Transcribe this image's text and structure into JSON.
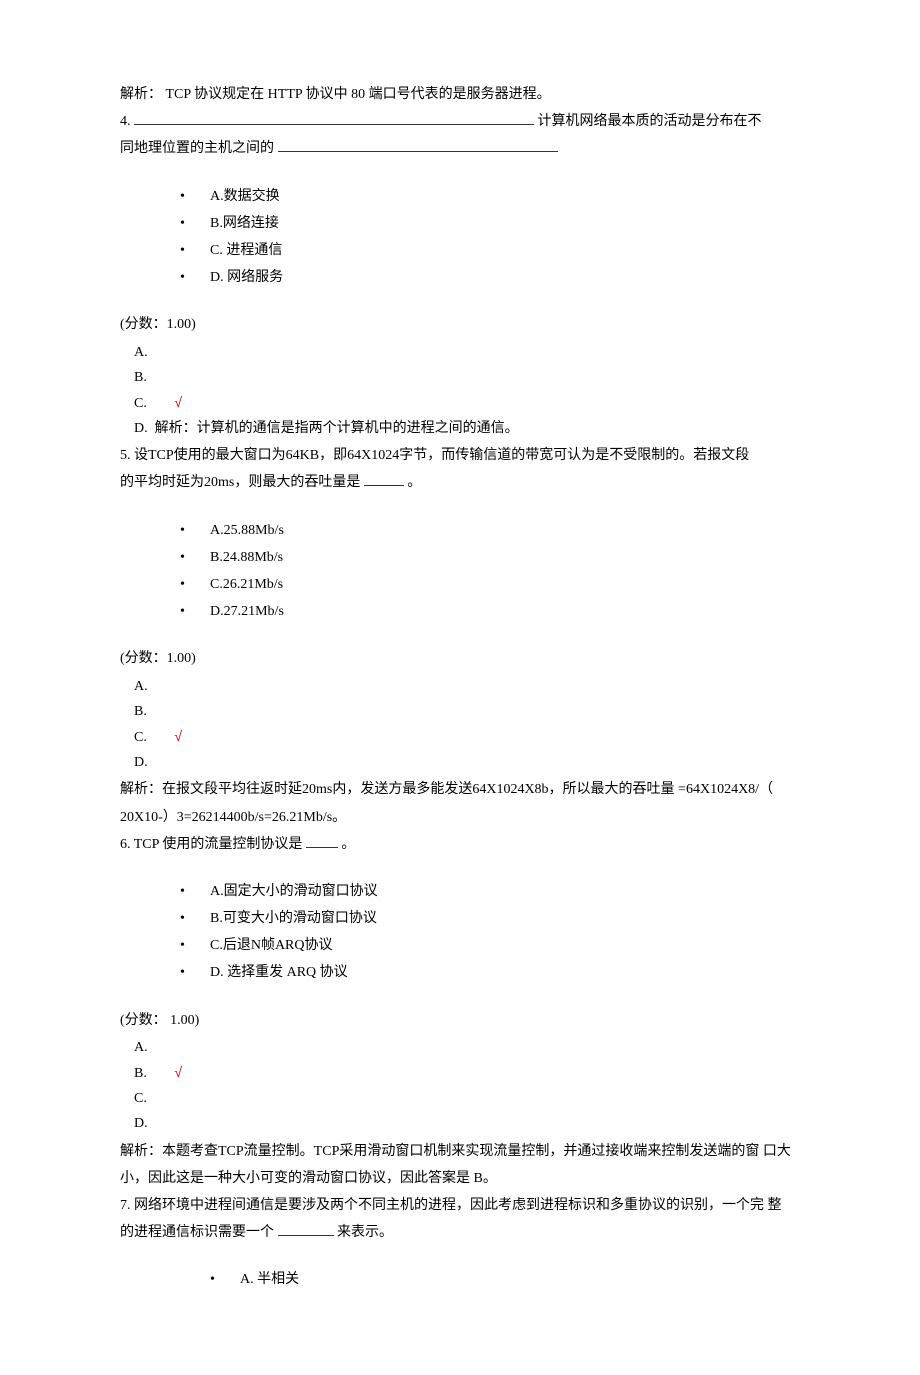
{
  "q3_analysis": "解析： TCP 协议规定在 HTTP 协议中 80 端口号代表的是服务器进程。",
  "q4": {
    "num": "4.",
    "stem_part1": "计算机网络最本质的活动是分布在不",
    "stem_part2": "同地理位置的主机之间的",
    "options": {
      "A": "A.数据交换",
      "B": "B.网络连接",
      "C": "C. 进程通信",
      "D": "D. 网络服务"
    },
    "score": "(分数：1.00)",
    "ans": {
      "A": "A.",
      "B": "B.",
      "C": "C.",
      "D": "D."
    },
    "check": "√",
    "analysis": "解析：计算机的通信是指两个计算机中的进程之间的通信。"
  },
  "q5": {
    "stem1": "5. 设TCP使用的最大窗口为64KB，即64X1024字节，而传输信道的带宽可认为是不受限制的。若报文段",
    "stem2a": "的平均时延为20ms，则最大的吞吐量是",
    "stem2b": "。",
    "options": {
      "A": "A.25.88Mb/s",
      "B": "B.24.88Mb/s",
      "C": "C.26.21Mb/s",
      "D": "D.27.21Mb/s"
    },
    "score": "(分数：1.00)",
    "ans": {
      "A": "A.",
      "B": "B.",
      "C": "C.",
      "D": "D."
    },
    "check": "√",
    "analysis1": "解析：在报文段平均往返时延20ms内，发送方最多能发送64X1024X8b，所以最大的吞吐量 =64X1024X8/（",
    "analysis2": "20X10-）3=26214400b/s=26.21Mb/s。"
  },
  "q6": {
    "stem_a": "6. TCP 使用的流量控制协议是",
    "stem_b": "。",
    "options": {
      "A": "A.固定大小的滑动窗口协议",
      "B": "B.可变大小的滑动窗口协议",
      "C": "C.后退N帧ARQ协议",
      "D": "D. 选择重发 ARQ 协议"
    },
    "score": "(分数： 1.00)",
    "ans": {
      "A": "A.",
      "B": "B.",
      "C": "C.",
      "D": "D."
    },
    "check": "√",
    "analysis1": "解析：本题考查TCP流量控制。TCP采用滑动窗口机制来实现流量控制，并通过接收端来控制发送端的窗 口大",
    "analysis2": "小，因此这是一种大小可变的滑动窗口协议，因此答案是 B。"
  },
  "q7": {
    "stem1": "7. 网络环境中进程间通信是要涉及两个不同主机的进程，因此考虑到进程标识和多重协议的识别，一个完 整",
    "stem2a": "的进程通信标识需要一个 ",
    "stem2b": "来表示。",
    "options": {
      "A": "A. 半相关"
    }
  }
}
